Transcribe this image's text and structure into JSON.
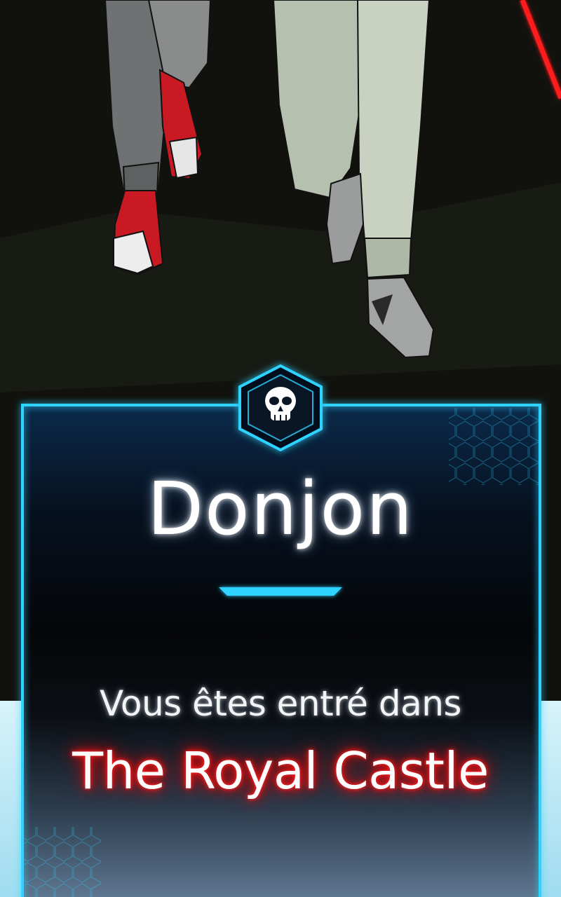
{
  "panel": {
    "header_icon": "skull-icon",
    "title": "Donjon",
    "subtitle": "Vous êtes entré dans",
    "dungeon_name": "The Royal Castle"
  },
  "colors": {
    "frame_glow": "#2fd3ff",
    "panel_top": "#0b2a4a",
    "panel_bottom": "#5f7a94",
    "dungeon_name_glow": "#ff1a1a",
    "background_bottom": "#bfe9f6"
  }
}
